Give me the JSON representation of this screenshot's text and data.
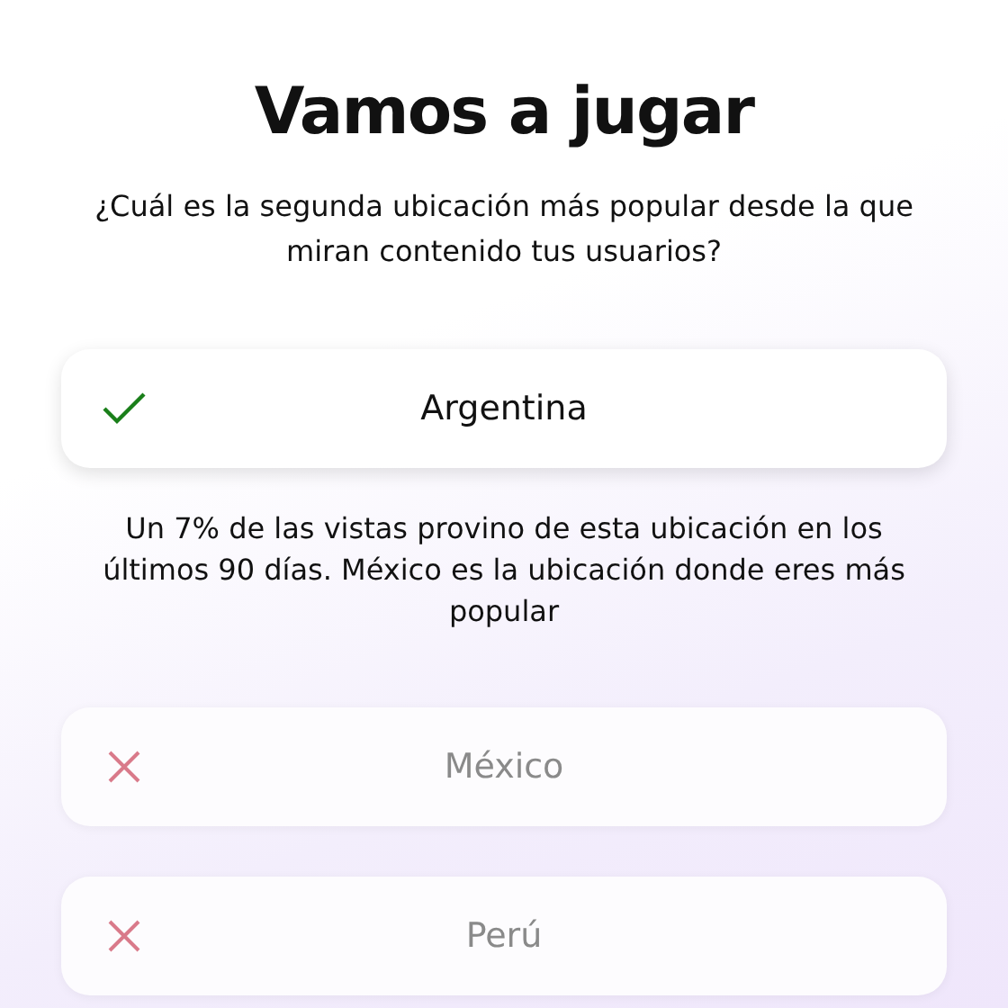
{
  "title": "Vamos a jugar",
  "question": "¿Cuál es la segunda ubicación más popular desde la que miran contenido tus usuarios?",
  "options": [
    {
      "label": "Argentina",
      "kind": "correct",
      "explanation": "Un 7% de las vistas provino de esta ubicación en los últimos 90 días. México es la ubicación donde eres más popular"
    },
    {
      "label": "México",
      "kind": "wrong"
    },
    {
      "label": "Perú",
      "kind": "wrong"
    }
  ]
}
